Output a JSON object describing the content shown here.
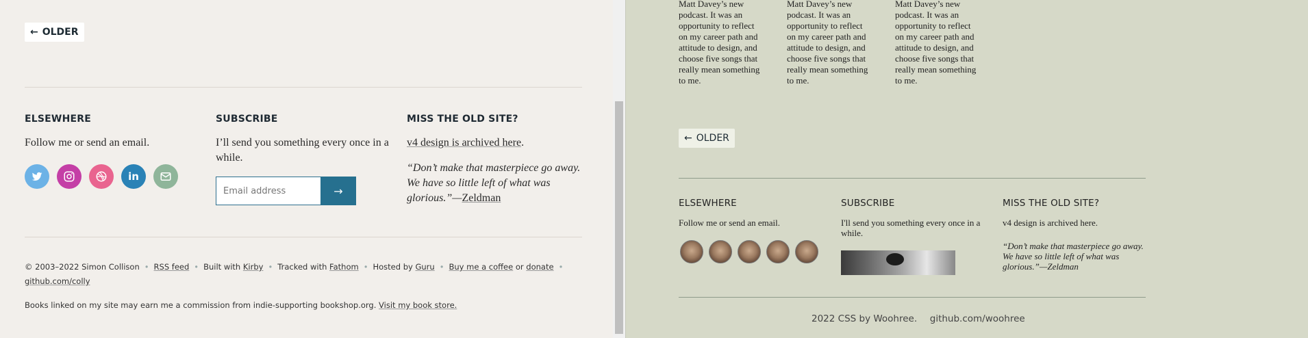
{
  "left": {
    "older_label": "OLDER",
    "older_arrow": "←",
    "elsewhere": {
      "title": "ELSEWHERE",
      "text": "Follow me or send an email.",
      "icons": [
        "twitter-icon",
        "instagram-icon",
        "dribbble-icon",
        "linkedin-icon",
        "email-icon"
      ],
      "icon_colors": [
        "#6cb2e6",
        "#c43fa6",
        "#e9648f",
        "#2a82b6",
        "#8fb59a"
      ]
    },
    "subscribe": {
      "title": "SUBSCRIBE",
      "text": "I’ll send you something every once in a while.",
      "email_placeholder": "Email address",
      "submit_label": "→"
    },
    "old_site": {
      "title": "MISS THE OLD SITE?",
      "link": "v4 design is archived here",
      "link_suffix": ".",
      "quote": "“Don’t make that masterpiece go away. We have so little left of what was glorious.”—",
      "quote_author": "Zeldman"
    },
    "footer": {
      "copyright": "© 2003–2022 Simon Collison",
      "rss": "RSS feed",
      "built_prefix": "Built with",
      "built_link": "Kirby",
      "tracked_prefix": "Tracked with",
      "tracked_link": "Fathom",
      "hosted_prefix": "Hosted by",
      "hosted_link": "Guru",
      "coffee": "Buy me a coffee",
      "or": "or",
      "donate": "donate",
      "github": "github.com/colly",
      "bookshop_text": "Books linked on my site may earn me a commission from indie-supporting bookshop.org.",
      "bookshop_link": "Visit my book store."
    }
  },
  "right": {
    "column_text": "Matt Davey’s new podcast. It was an opportunity to reflect on my career path and attitude to design, and choose five songs that really mean something to me.",
    "older_label": "OLDER",
    "older_arrow": "←",
    "elsewhere_title": "ELSEWHERE",
    "elsewhere_text": "Follow me or send an email.",
    "subscribe_title": "SUBSCRIBE",
    "subscribe_text": "I'll send you something every once in a while.",
    "old_title": "MISS THE OLD SITE?",
    "old_text": "v4 design is archived here.",
    "old_quote": "“Don’t make that masterpiece go away. We have so little left of what was glorious.”—Zeldman",
    "footer_credit": "2022 CSS by Woohree.",
    "footer_link": "github.com/woohree"
  }
}
